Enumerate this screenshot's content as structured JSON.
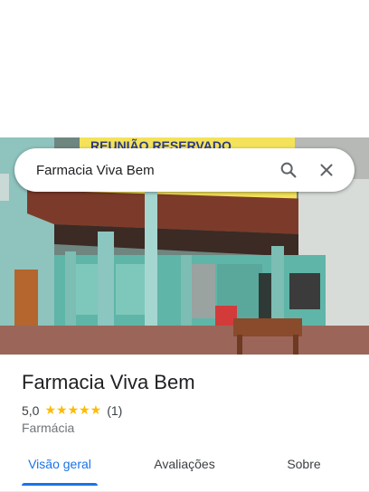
{
  "search": {
    "query": "Farmacia Viva Bem",
    "search_icon": "search-icon",
    "close_icon": "close-icon"
  },
  "photo": {
    "description_icon": "place-photo",
    "banner_text": "REUNIÃO RESERVADO"
  },
  "place": {
    "title": "Farmacia Viva Bem",
    "rating": "5,0",
    "stars": "★★★★★",
    "review_count": "(1)",
    "category": "Farmácia"
  },
  "tabs": [
    {
      "label": "Visão geral",
      "active": true
    },
    {
      "label": "Avaliações",
      "active": false
    },
    {
      "label": "Sobre",
      "active": false
    }
  ],
  "colors": {
    "accent": "#1a73e8",
    "star": "#fbbc04",
    "text_primary": "#202124",
    "text_secondary": "#70757a"
  }
}
